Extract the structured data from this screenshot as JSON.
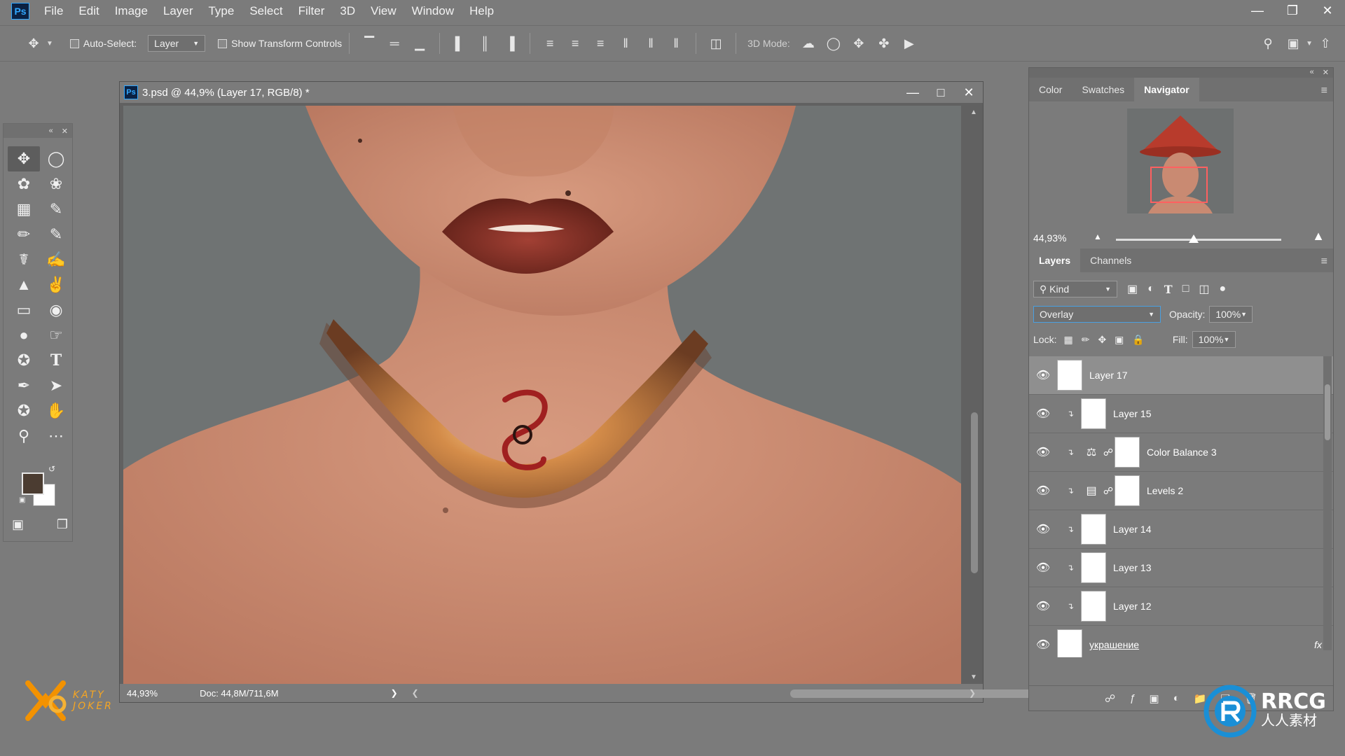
{
  "app": {
    "logo": "Ps"
  },
  "menu": [
    "File",
    "Edit",
    "Image",
    "Layer",
    "Type",
    "Select",
    "Filter",
    "3D",
    "View",
    "Window",
    "Help"
  ],
  "options_bar": {
    "auto_select_label": "Auto-Select:",
    "auto_select_value": "Layer",
    "show_transform_label": "Show Transform Controls",
    "mode_3d_label": "3D Mode:"
  },
  "document": {
    "title": "3.psd @ 44,9% (Layer 17, RGB/8) *",
    "zoom": "44,93%",
    "doc_size": "Doc: 44,8M/711,6M"
  },
  "colors": {
    "foreground": "#4b3c31",
    "background": "#ffffff",
    "accent": "#31a8ff"
  },
  "top_panel": {
    "tabs": [
      "Color",
      "Swatches",
      "Navigator"
    ],
    "active_tab": "Navigator",
    "zoom": "44,93%"
  },
  "layers_panel": {
    "tabs": [
      "Layers",
      "Channels"
    ],
    "kind_label": "Kind",
    "blend_mode": "Overlay",
    "opacity_label": "Opacity:",
    "opacity_value": "100%",
    "lock_label": "Lock:",
    "fill_label": "Fill:",
    "fill_value": "100%",
    "layers": [
      {
        "name": "Layer 17",
        "type": "pixel",
        "selected": true,
        "clipped": false
      },
      {
        "name": "Layer 15",
        "type": "pixel",
        "selected": false,
        "clipped": true
      },
      {
        "name": "Color Balance 3",
        "type": "color-balance",
        "selected": false,
        "clipped": true
      },
      {
        "name": "Levels 2",
        "type": "levels",
        "selected": false,
        "clipped": true
      },
      {
        "name": "Layer 14",
        "type": "pixel",
        "selected": false,
        "clipped": true
      },
      {
        "name": "Layer 13",
        "type": "pixel",
        "selected": false,
        "clipped": true
      },
      {
        "name": "Layer 12",
        "type": "pixel",
        "selected": false,
        "clipped": true
      },
      {
        "name": "украшение",
        "type": "pixel",
        "selected": false,
        "clipped": false
      }
    ],
    "fx_label": "fx"
  },
  "branding": {
    "katy_line1": "KATY",
    "katy_line2": "JOKER",
    "rrcg_line1": "RRCG",
    "rrcg_line2": "人人素材"
  }
}
